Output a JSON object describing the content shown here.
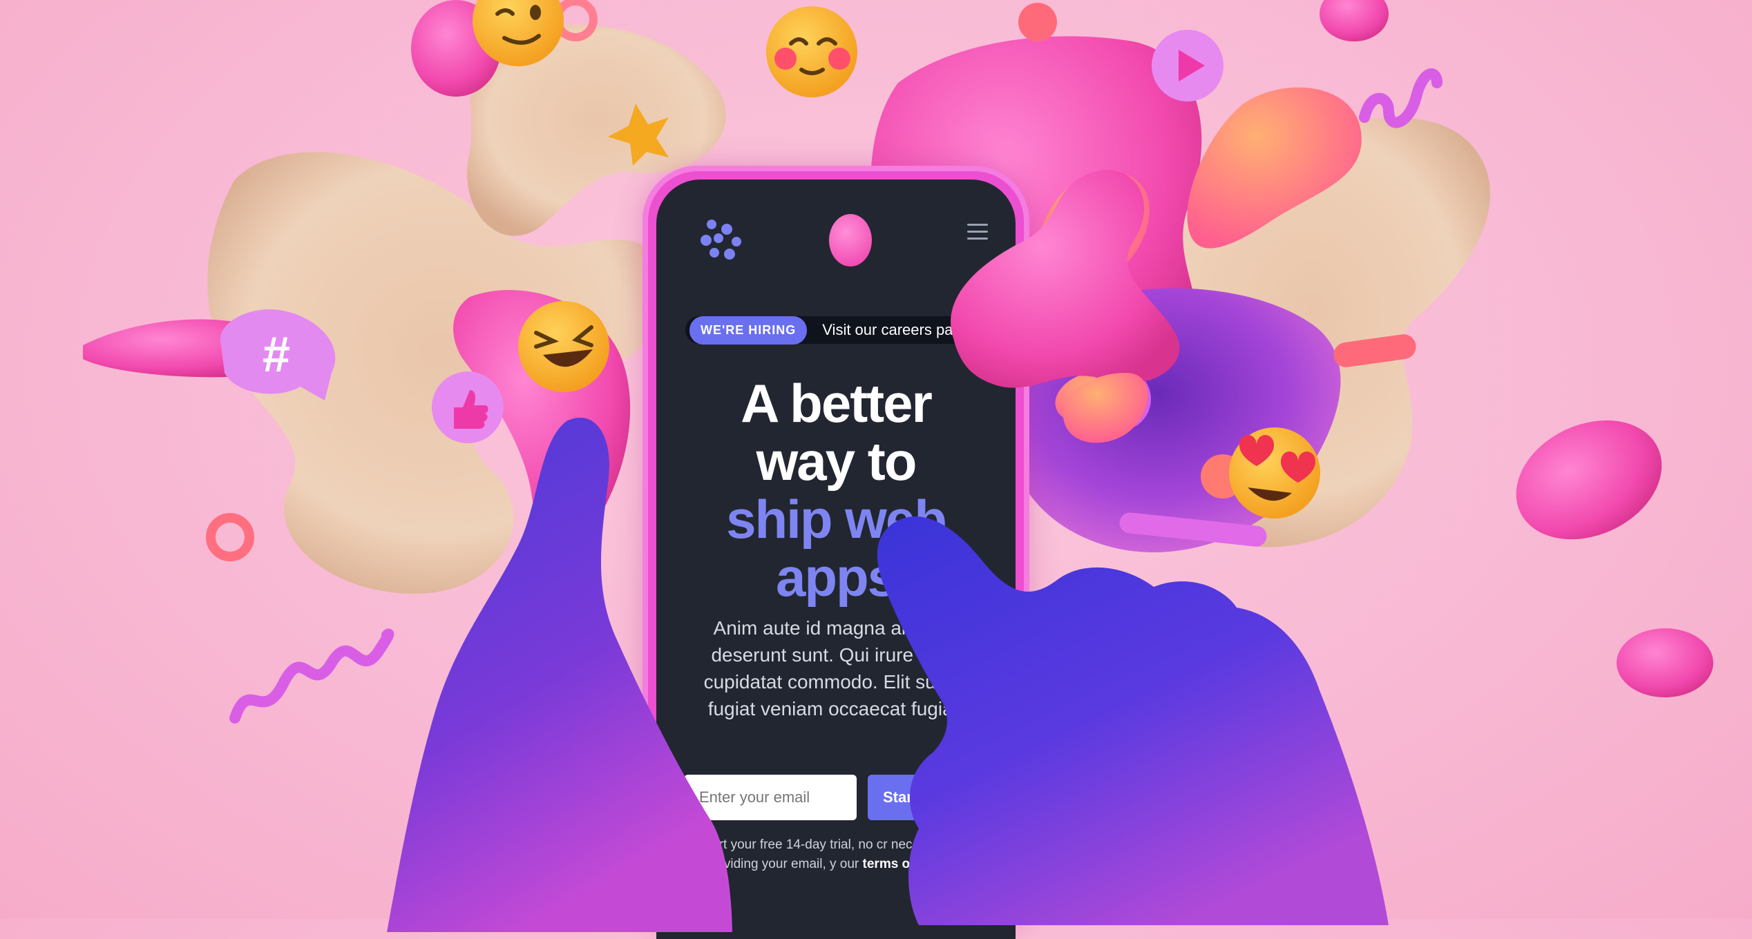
{
  "phone": {
    "badge": "WE'RE HIRING",
    "hiring_link": "Visit our careers pa",
    "headline_line1": "A better",
    "headline_line2": "way to",
    "headline_line3": "ship web",
    "headline_line4": "apps",
    "subtext": "Anim aute id magna aliqua a deserunt sunt. Qui irure qui L cupidatat commodo. Elit sunt a fugiat veniam occaecat fugiat.",
    "email_placeholder": "Enter your email",
    "start_button": "Star",
    "fine_print_prefix": "Start your free 14-day trial, no cr necessary. By providing your email, y our ",
    "fine_print_link": "terms of service",
    "fine_print_suffix": "."
  },
  "icons": {
    "logo": "app-logo-icon",
    "menu": "hamburger-menu-icon",
    "hashtag": "hashtag-bubble-icon",
    "play": "play-button-icon",
    "thumbs_up": "thumbs-up-icon"
  },
  "colors": {
    "background": "#f8b8d3",
    "phone_frame": "#ec4fd0",
    "screen": "#222630",
    "accent": "#6a6ff0",
    "accent_text": "#7e85f2",
    "hand": "#5a3fe0"
  }
}
